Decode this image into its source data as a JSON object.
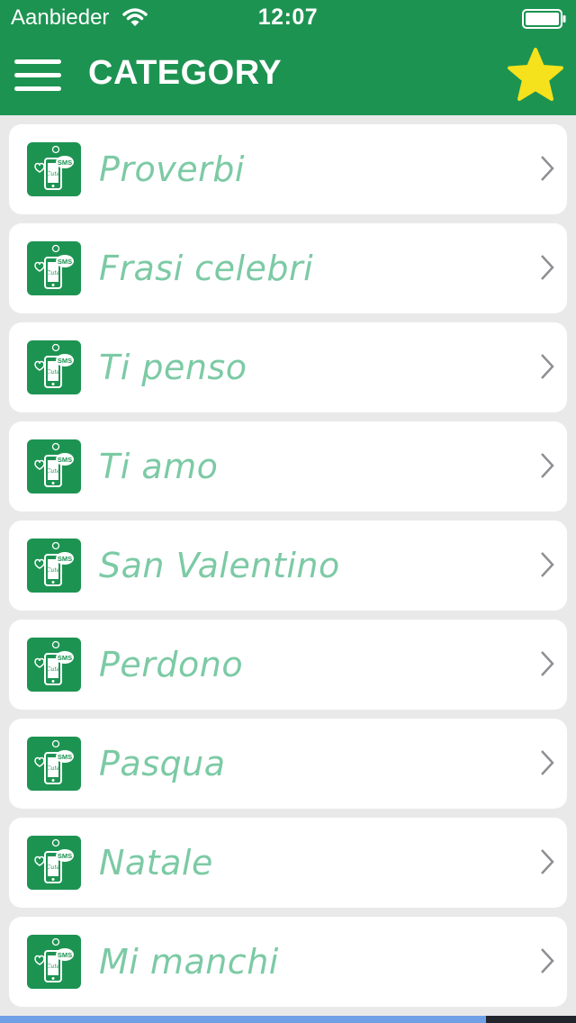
{
  "status_bar": {
    "carrier": "Aanbieder",
    "time": "12:07"
  },
  "nav": {
    "title": "CATEGORY"
  },
  "categories": [
    {
      "label": "Proverbi"
    },
    {
      "label": "Frasi celebri"
    },
    {
      "label": "Ti penso"
    },
    {
      "label": "Ti amo"
    },
    {
      "label": "San Valentino"
    },
    {
      "label": "Perdono"
    },
    {
      "label": "Pasqua"
    },
    {
      "label": "Natale"
    },
    {
      "label": "Mi manchi"
    }
  ],
  "icon_text": {
    "sms": "SMS",
    "cute": "Cute"
  },
  "colors": {
    "brand_green": "#1d9352",
    "label_green": "#7ccaa5",
    "star_yellow": "#f5e21c",
    "background": "#e9e9ea"
  }
}
